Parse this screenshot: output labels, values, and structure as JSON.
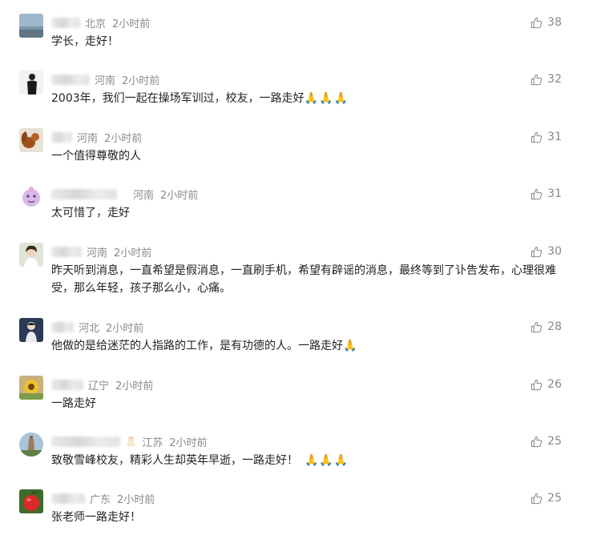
{
  "comments": [
    {
      "region": "北京",
      "time": "2小时前",
      "text": "学长，走好！",
      "emoji": "",
      "likes": "38",
      "avatar": "sky"
    },
    {
      "region": "河南",
      "time": "2小时前",
      "text": "2003年，我们一起在操场军训过，校友，一路走好",
      "emoji": "🙏🙏🙏",
      "likes": "32",
      "avatar": "person-dark"
    },
    {
      "region": "河南",
      "time": "2小时前",
      "text": "一个值得尊敬的人",
      "emoji": "",
      "likes": "31",
      "avatar": "squirrel"
    },
    {
      "region": "河南",
      "time": "2小时前",
      "text": "太可惜了，走好",
      "emoji": "",
      "likes": "31",
      "avatar": "purple-cartoon"
    },
    {
      "region": "河南",
      "time": "2小时前",
      "text": "昨天听到消息，一直希望是假消息，一直刷手机，希望有辟谣的消息，最终等到了讣告发布，心理很难受，那么年轻，孩子那么小，心痛。",
      "emoji": "",
      "likes": "30",
      "avatar": "portrait"
    },
    {
      "region": "河北",
      "time": "2小时前",
      "text": "他做的是给迷茫的人指路的工作，是有功德的人。一路走好",
      "emoji": "🙏",
      "likes": "28",
      "avatar": "boy"
    },
    {
      "region": "辽宁",
      "time": "2小时前",
      "text": "一路走好",
      "emoji": "",
      "likes": "26",
      "avatar": "sunflower"
    },
    {
      "region": "江苏",
      "time": "2小时前",
      "text": "致敬雪峰校友，精彩人生却英年早逝，一路走好！",
      "emoji": "🙏🙏🙏",
      "likes": "25",
      "avatar": "tower",
      "badge": "🎗"
    },
    {
      "region": "广东",
      "time": "2小时前",
      "text": "张老师一路走好！",
      "emoji": "",
      "likes": "25",
      "avatar": "red-fruit"
    }
  ],
  "colors": {
    "meta": "#8a8a8a",
    "text": "#222222",
    "like": "#888888"
  },
  "icons": {
    "like": "thumbs-up-icon"
  }
}
